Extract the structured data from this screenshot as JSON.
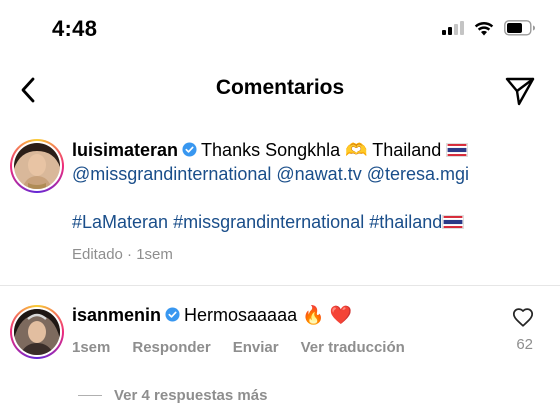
{
  "status_bar": {
    "time": "4:48",
    "icons": [
      "signal-icon",
      "wifi-icon",
      "battery-icon"
    ]
  },
  "nav": {
    "title": "Comentarios",
    "back_icon": "chevron-left-icon",
    "share_icon": "paper-plane-icon"
  },
  "caption": {
    "username": "luisimateran",
    "verified": true,
    "text_1": "Thanks Songkhla",
    "emoji_hands": "🫶",
    "text_2": "Thailand",
    "mentions": [
      "@missgrandinternational",
      "@nawat.tv",
      "@teresa.mgi"
    ],
    "hashtags": [
      "#LaMateran",
      "#missgrandinternational",
      "#thailand"
    ],
    "edited_label": "Editado",
    "separator": "·",
    "time": "1sem"
  },
  "comment": {
    "username": "isanmenin",
    "verified": true,
    "text": "Hermosaaaaa",
    "emojis": "🔥 ❤️",
    "time": "1sem",
    "reply_label": "Responder",
    "send_label": "Enviar",
    "translate_label": "Ver traducción",
    "like_count": "62",
    "view_replies": "Ver 4 respuestas más"
  },
  "colors": {
    "link": "#1a4e8a",
    "muted": "#8e8e8e",
    "verified": "#3897f0"
  }
}
